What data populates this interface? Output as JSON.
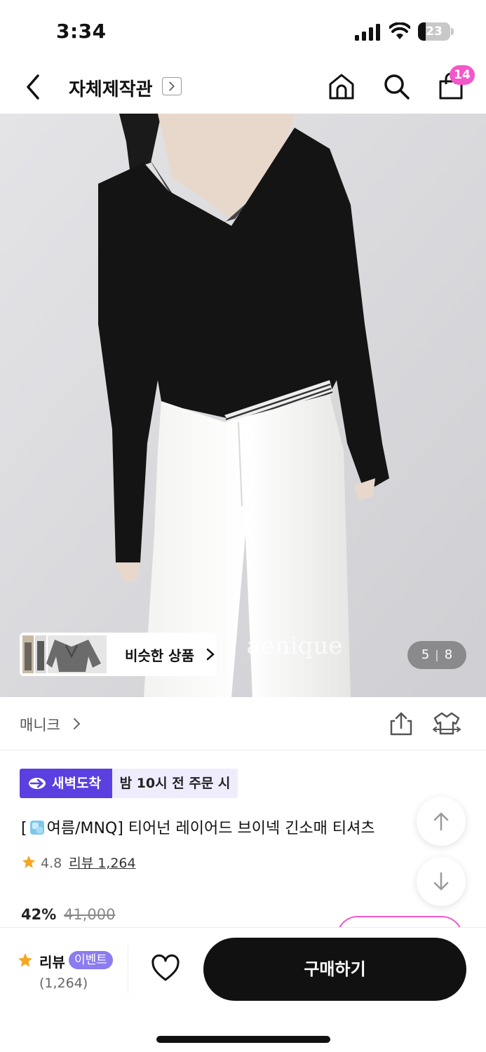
{
  "status_bar": {
    "time": "3:34",
    "battery": "23",
    "battery_level": 0.23
  },
  "nav": {
    "title": "자체제작관",
    "cart_count": "14"
  },
  "hero": {
    "watermark": "aenique",
    "similar_label": "비슷한 상품",
    "image_index": "5",
    "image_total": "8"
  },
  "brand": {
    "name": "매니크"
  },
  "delivery": {
    "tag": "새벽도착",
    "note": "밤 10시 전 주문 시"
  },
  "product": {
    "title_open": "[",
    "title_rest": "여름/MNQ] 티어넌 레이어드 브이넥 긴소매 티셔츠",
    "rating": "4.8",
    "review_link": "리뷰 1,264",
    "discount": "42%",
    "original_price": "41,000"
  },
  "bottom_bar": {
    "review_label": "리뷰",
    "event_badge": "이벤트",
    "review_count": "(1,264)",
    "buy_label": "구매하기"
  },
  "colors": {
    "accent_pink": "#f357c9",
    "delivery_purple": "#5b3fe0",
    "star": "#f5a623"
  }
}
